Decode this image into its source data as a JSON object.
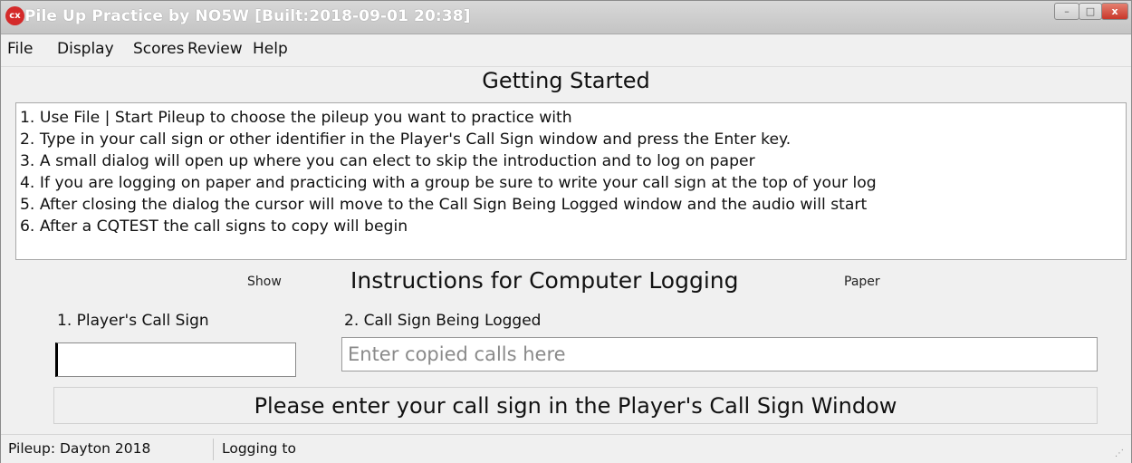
{
  "window": {
    "title": "Pile Up Practice by NO5W [Built:2018-09-01 20:38]",
    "icon_text": "cx",
    "controls": {
      "minimize": "–",
      "maximize": "□",
      "close": "x"
    }
  },
  "menu": {
    "items": [
      "File",
      "Display",
      "Scores",
      "Review",
      "Help"
    ]
  },
  "getting_started": {
    "title": "Getting Started",
    "lines": [
      "1. Use File | Start Pileup to choose the pileup you want to practice with",
      "2. Type in your call sign or other identifier in the Player's Call Sign window and press the Enter key.",
      "3. A small dialog will open up where you can elect to skip the introduction and to log on paper",
      "4. If you are logging on paper and practicing with a group be sure to write your call sign at the top of your log",
      "5. After closing the dialog the cursor will move to the Call Sign Being Logged window and the audio will start",
      "6. After a CQTEST the call signs to copy will begin"
    ]
  },
  "mode": {
    "show_label": "Show",
    "title": "Instructions for Computer Logging",
    "paper_label": "Paper"
  },
  "fields": {
    "player_call_label": "1. Player's Call Sign",
    "player_call_value": "",
    "logged_call_label": "2. Call Sign Being Logged",
    "logged_call_placeholder": "Enter copied calls here",
    "logged_call_value": ""
  },
  "message": "Please enter your call sign in the Player's Call Sign Window",
  "status": {
    "pileup": "Pileup: Dayton 2018",
    "logging": "Logging to"
  },
  "colors": {
    "background": "#f0f0f0",
    "close_button": "#c9372a",
    "app_icon": "#d42a2a"
  }
}
